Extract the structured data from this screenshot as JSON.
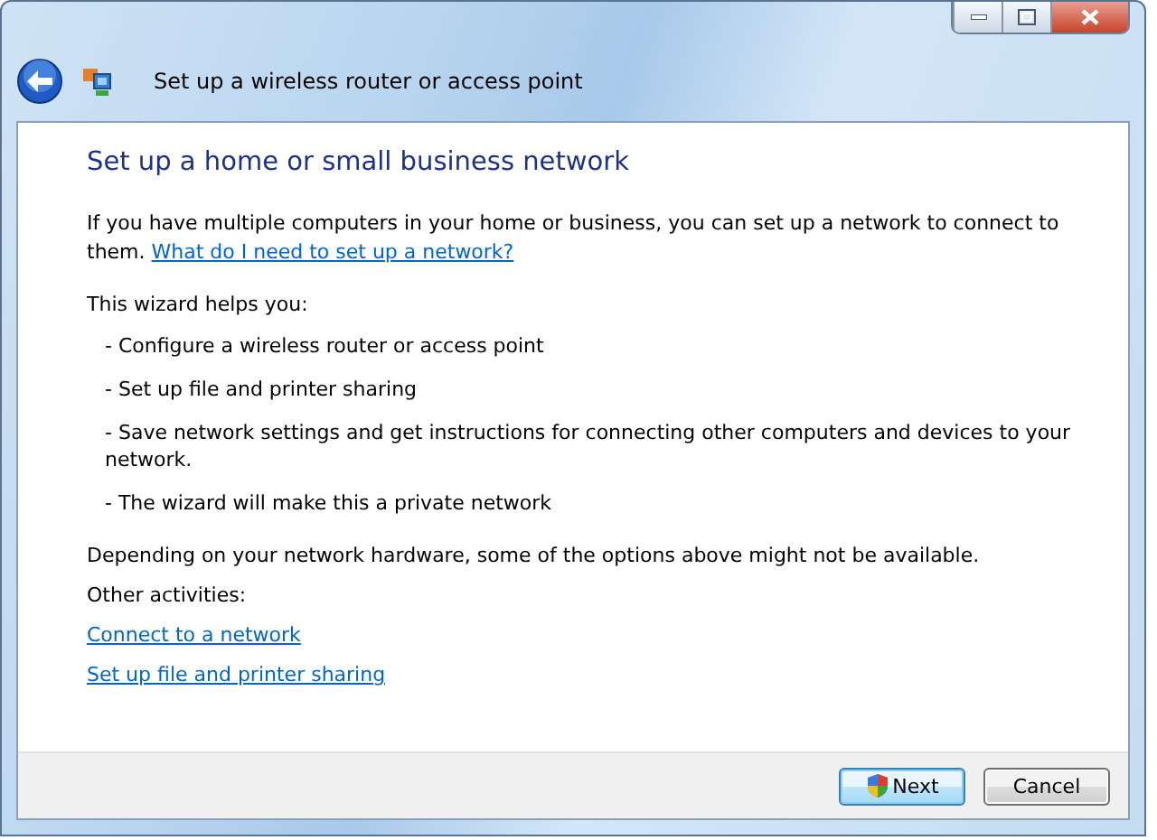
{
  "window": {
    "title": "Set up a wireless router or access point"
  },
  "heading": "Set up a home or small business network",
  "intro": {
    "text": "If you have multiple computers in your home or business, you can set up a network to connect to them.",
    "link": "What do I need to set up a network?"
  },
  "helps_label": "This wizard helps you:",
  "bullets": [
    "- Configure a wireless router or access point",
    "- Set up file and printer sharing",
    "- Save network settings and get instructions for connecting other computers and devices to your network.",
    "- The wizard will make this a private network"
  ],
  "note": "Depending on your network hardware, some of the options above might not be available.",
  "other_label": "Other activities:",
  "links": [
    "Connect to a network",
    "Set up file and printer sharing"
  ],
  "buttons": [
    {
      "label": "Next",
      "default": true,
      "shield": true
    },
    {
      "label": "Cancel",
      "default": false,
      "shield": false
    }
  ]
}
